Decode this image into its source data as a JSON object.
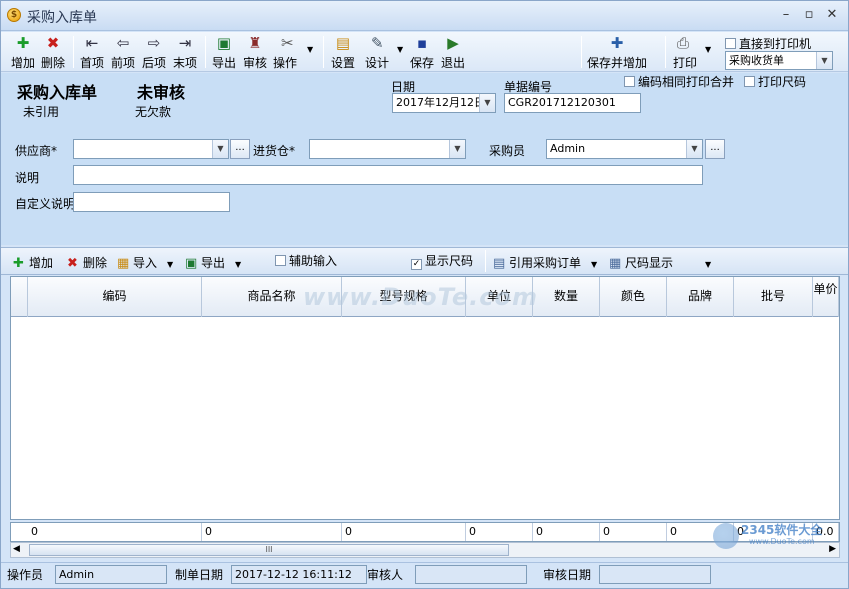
{
  "window": {
    "title": "采购入库单"
  },
  "toolbar": {
    "add": "增加",
    "delete": "删除",
    "first": "首项",
    "prev": "前项",
    "next": "后项",
    "last": "末项",
    "export": "导出",
    "audit": "审核",
    "operate": "操作",
    "settings": "设置",
    "design": "设计",
    "save": "保存",
    "exit": "退出",
    "save_add": "保存并增加",
    "print": "打印",
    "print_direct": "直接到打印机",
    "print_template": "采购收货单"
  },
  "header": {
    "doc_title": "采购入库单",
    "audit_status": "未审核",
    "ref_status": "未引用",
    "debt_status": "无欠款",
    "date_label": "日期",
    "date_value": "2017年12月12日",
    "doc_no_label": "单据编号",
    "doc_no_value": "CGR201712120301",
    "merge_print": "编码相同打印合并",
    "print_size": "打印尺码"
  },
  "form": {
    "supplier_label": "供应商*",
    "warehouse_label": "进货仓*",
    "buyer_label": "采购员",
    "buyer_value": "Admin",
    "note_label": "说明",
    "custom_note_label": "自定义说明",
    "ellipsis": "..."
  },
  "grid_toolbar": {
    "add": "增加",
    "delete": "删除",
    "import": "导入",
    "export": "导出",
    "assist_input": "辅助输入",
    "show_size": "显示尺码",
    "ref_order": "引用采购订单",
    "size_display": "尺码显示"
  },
  "grid": {
    "columns": [
      "编码",
      "商品名称",
      "型号规格",
      "单位",
      "数量",
      "颜色",
      "品牌",
      "批号",
      "单价"
    ],
    "footer": [
      "0",
      "0",
      "0",
      "0",
      "0",
      "0",
      "0",
      "0",
      "0.0"
    ],
    "scroll_grip": "III"
  },
  "status": {
    "operator_label": "操作员",
    "operator_value": "Admin",
    "created_label": "制单日期",
    "created_value": "2017-12-12 16:11:12",
    "auditor_label": "审核人",
    "auditor_value": "",
    "audit_date_label": "审核日期",
    "audit_date_value": ""
  },
  "watermark": {
    "main": "www.DuoTe.com",
    "corner": "2345软件大全",
    "corner_sub": "www.DuoTe.com"
  }
}
